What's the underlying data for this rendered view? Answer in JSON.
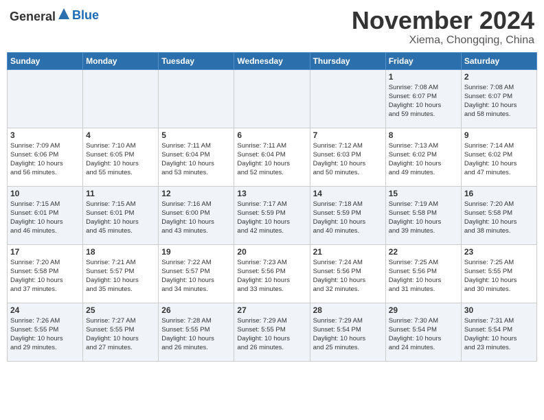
{
  "header": {
    "logo_general": "General",
    "logo_blue": "Blue",
    "month": "November 2024",
    "location": "Xiema, Chongqing, China"
  },
  "weekdays": [
    "Sunday",
    "Monday",
    "Tuesday",
    "Wednesday",
    "Thursday",
    "Friday",
    "Saturday"
  ],
  "weeks": [
    [
      {
        "day": "",
        "info": ""
      },
      {
        "day": "",
        "info": ""
      },
      {
        "day": "",
        "info": ""
      },
      {
        "day": "",
        "info": ""
      },
      {
        "day": "",
        "info": ""
      },
      {
        "day": "1",
        "info": "Sunrise: 7:08 AM\nSunset: 6:07 PM\nDaylight: 10 hours\nand 59 minutes."
      },
      {
        "day": "2",
        "info": "Sunrise: 7:08 AM\nSunset: 6:07 PM\nDaylight: 10 hours\nand 58 minutes."
      }
    ],
    [
      {
        "day": "3",
        "info": "Sunrise: 7:09 AM\nSunset: 6:06 PM\nDaylight: 10 hours\nand 56 minutes."
      },
      {
        "day": "4",
        "info": "Sunrise: 7:10 AM\nSunset: 6:05 PM\nDaylight: 10 hours\nand 55 minutes."
      },
      {
        "day": "5",
        "info": "Sunrise: 7:11 AM\nSunset: 6:04 PM\nDaylight: 10 hours\nand 53 minutes."
      },
      {
        "day": "6",
        "info": "Sunrise: 7:11 AM\nSunset: 6:04 PM\nDaylight: 10 hours\nand 52 minutes."
      },
      {
        "day": "7",
        "info": "Sunrise: 7:12 AM\nSunset: 6:03 PM\nDaylight: 10 hours\nand 50 minutes."
      },
      {
        "day": "8",
        "info": "Sunrise: 7:13 AM\nSunset: 6:02 PM\nDaylight: 10 hours\nand 49 minutes."
      },
      {
        "day": "9",
        "info": "Sunrise: 7:14 AM\nSunset: 6:02 PM\nDaylight: 10 hours\nand 47 minutes."
      }
    ],
    [
      {
        "day": "10",
        "info": "Sunrise: 7:15 AM\nSunset: 6:01 PM\nDaylight: 10 hours\nand 46 minutes."
      },
      {
        "day": "11",
        "info": "Sunrise: 7:15 AM\nSunset: 6:01 PM\nDaylight: 10 hours\nand 45 minutes."
      },
      {
        "day": "12",
        "info": "Sunrise: 7:16 AM\nSunset: 6:00 PM\nDaylight: 10 hours\nand 43 minutes."
      },
      {
        "day": "13",
        "info": "Sunrise: 7:17 AM\nSunset: 5:59 PM\nDaylight: 10 hours\nand 42 minutes."
      },
      {
        "day": "14",
        "info": "Sunrise: 7:18 AM\nSunset: 5:59 PM\nDaylight: 10 hours\nand 40 minutes."
      },
      {
        "day": "15",
        "info": "Sunrise: 7:19 AM\nSunset: 5:58 PM\nDaylight: 10 hours\nand 39 minutes."
      },
      {
        "day": "16",
        "info": "Sunrise: 7:20 AM\nSunset: 5:58 PM\nDaylight: 10 hours\nand 38 minutes."
      }
    ],
    [
      {
        "day": "17",
        "info": "Sunrise: 7:20 AM\nSunset: 5:58 PM\nDaylight: 10 hours\nand 37 minutes."
      },
      {
        "day": "18",
        "info": "Sunrise: 7:21 AM\nSunset: 5:57 PM\nDaylight: 10 hours\nand 35 minutes."
      },
      {
        "day": "19",
        "info": "Sunrise: 7:22 AM\nSunset: 5:57 PM\nDaylight: 10 hours\nand 34 minutes."
      },
      {
        "day": "20",
        "info": "Sunrise: 7:23 AM\nSunset: 5:56 PM\nDaylight: 10 hours\nand 33 minutes."
      },
      {
        "day": "21",
        "info": "Sunrise: 7:24 AM\nSunset: 5:56 PM\nDaylight: 10 hours\nand 32 minutes."
      },
      {
        "day": "22",
        "info": "Sunrise: 7:25 AM\nSunset: 5:56 PM\nDaylight: 10 hours\nand 31 minutes."
      },
      {
        "day": "23",
        "info": "Sunrise: 7:25 AM\nSunset: 5:55 PM\nDaylight: 10 hours\nand 30 minutes."
      }
    ],
    [
      {
        "day": "24",
        "info": "Sunrise: 7:26 AM\nSunset: 5:55 PM\nDaylight: 10 hours\nand 29 minutes."
      },
      {
        "day": "25",
        "info": "Sunrise: 7:27 AM\nSunset: 5:55 PM\nDaylight: 10 hours\nand 27 minutes."
      },
      {
        "day": "26",
        "info": "Sunrise: 7:28 AM\nSunset: 5:55 PM\nDaylight: 10 hours\nand 26 minutes."
      },
      {
        "day": "27",
        "info": "Sunrise: 7:29 AM\nSunset: 5:55 PM\nDaylight: 10 hours\nand 26 minutes."
      },
      {
        "day": "28",
        "info": "Sunrise: 7:29 AM\nSunset: 5:54 PM\nDaylight: 10 hours\nand 25 minutes."
      },
      {
        "day": "29",
        "info": "Sunrise: 7:30 AM\nSunset: 5:54 PM\nDaylight: 10 hours\nand 24 minutes."
      },
      {
        "day": "30",
        "info": "Sunrise: 7:31 AM\nSunset: 5:54 PM\nDaylight: 10 hours\nand 23 minutes."
      }
    ]
  ]
}
